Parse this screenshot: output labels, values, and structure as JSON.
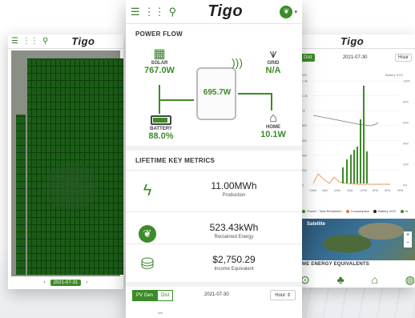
{
  "colors": {
    "accent": "#3b8c27",
    "text": "#222222",
    "muted": "#555555"
  },
  "icons": {
    "menu": "hamburger-icon",
    "grid": "grid-icon",
    "search": "search-icon",
    "profile": "leaf-icon",
    "solar": "solar-panel-icon",
    "grid_tower": "power-tower-icon",
    "home": "home-icon",
    "battery": "battery-icon",
    "inverter": "inverter-icon",
    "wifi": "wifi-icon",
    "production": "lightning-icon",
    "energy": "leaf-icon",
    "income": "coins-icon"
  },
  "brand": {
    "logo": "Tigo"
  },
  "center": {
    "power_flow": {
      "title": "POWER FLOW",
      "solar_label": "SOLAR",
      "solar_value": "767.0W",
      "grid_label": "GRID",
      "grid_value": "N/A",
      "inverter_value": "695.7W",
      "battery_label": "BATTERY",
      "battery_value": "88.0%",
      "battery_level": 0.88,
      "home_label": "HOME",
      "home_value": "10.1W"
    },
    "metrics": {
      "title": "LIFETIME KEY METRICS",
      "items": [
        {
          "value": "11.00MWh",
          "label": "Production"
        },
        {
          "value": "523.43kWh",
          "label": "Reclaimed Energy"
        },
        {
          "value": "$2,750.29",
          "label": "Income Equivalent"
        }
      ]
    },
    "bottom": {
      "tab_pv": "PV Gen",
      "tab_dist": "Dist",
      "date": "2021-07-30",
      "interval": "Hour",
      "interval_caret": "⇕",
      "unit": "Wh"
    }
  },
  "left": {
    "footer_prev": "‹",
    "footer_date": "2021-07-31",
    "footer_next": "›"
  },
  "right": {
    "tab_dist": "Dist",
    "date": "2021-07-30",
    "interval": "Hour",
    "chart": {
      "y_left_label": "Wh",
      "y_right_label": "Battery SOC",
      "y_left_ticks": [
        "1.4k",
        "1.2k",
        "1k",
        "800",
        "600",
        "400",
        "200",
        "0"
      ],
      "y_right_ticks": [
        "100%",
        "80%",
        "60%",
        "40%",
        "20%",
        "0%"
      ],
      "x_ticks": [
        "12AM",
        "3AM",
        "6AM",
        "9AM",
        "12PM",
        "3PM",
        "6PM",
        "9PM"
      ]
    },
    "legend": [
      "Power*, Total Reclaimed",
      "Consumption",
      "Battery SOC",
      "Hi"
    ],
    "map_label": "Satellite",
    "zoom_in": "+",
    "zoom_out": "−",
    "section_title": "ME ENERGY EQUIVALENTS"
  }
}
